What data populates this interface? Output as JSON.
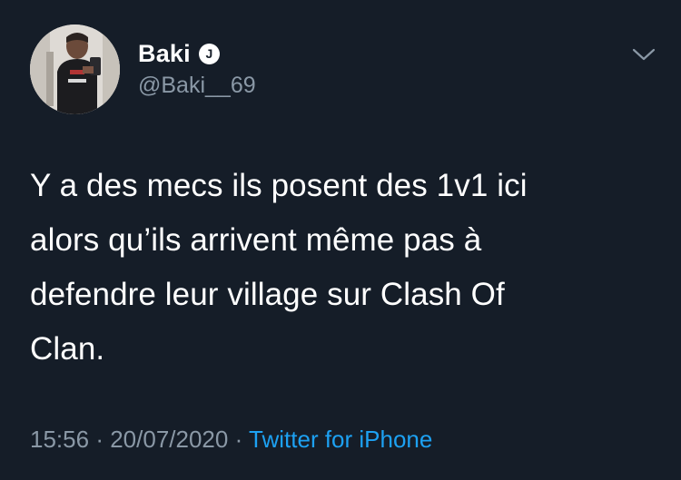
{
  "user": {
    "display_name": "Baki",
    "verified_badge_letter": "J",
    "handle": "@Baki__69",
    "avatar": "avatar-photo"
  },
  "tweet": {
    "text": "Y a des mecs ils posent des 1v1 ici\nalors qu’ils arrivent même pas à\ndefendre leur village sur Clash Of\nClan.",
    "time": "15:56",
    "separator": "·",
    "date": "20/07/2020",
    "source": "Twitter for iPhone"
  },
  "icons": {
    "menu": "chevron-down-icon",
    "badge": "verified-badge-icon"
  },
  "colors": {
    "background": "#151d28",
    "text": "#ffffff",
    "muted": "#8a98a6",
    "link": "#1da1f2"
  }
}
